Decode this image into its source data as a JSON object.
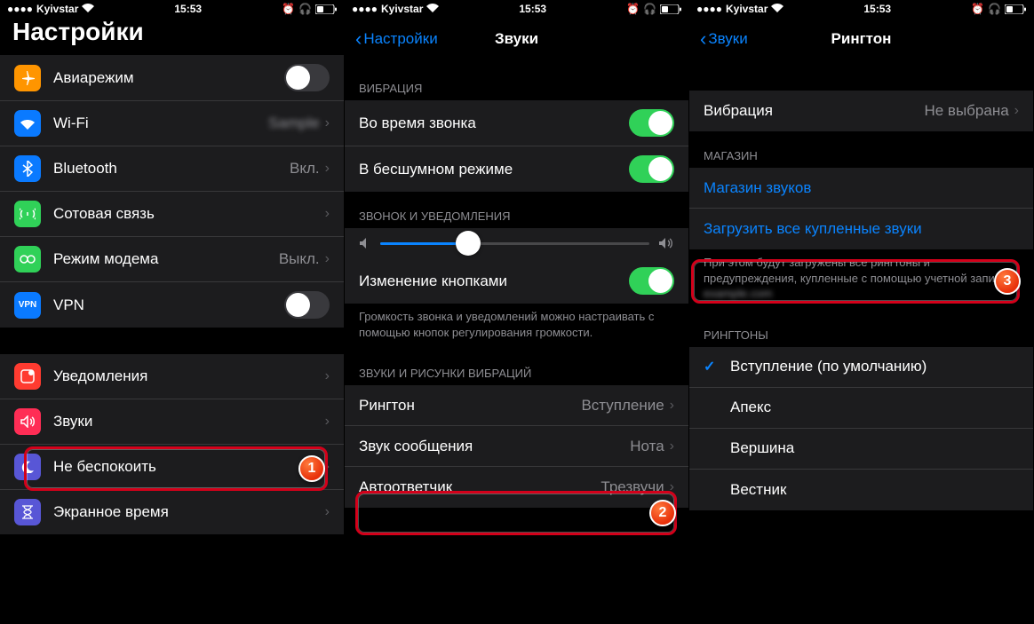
{
  "status": {
    "carrier": "Kyivstar",
    "time": "15:53"
  },
  "screen1": {
    "title": "Настройки",
    "group1": [
      {
        "icon": "airplane",
        "color": "#ff9500",
        "label": "Авиарежим",
        "toggle": false
      },
      {
        "icon": "wifi",
        "color": "#0a7aff",
        "label": "Wi-Fi",
        "value": "",
        "chevron": true
      },
      {
        "icon": "bluetooth",
        "color": "#0a7aff",
        "label": "Bluetooth",
        "value": "Вкл.",
        "chevron": true
      },
      {
        "icon": "cellular",
        "color": "#30d158",
        "label": "Сотовая связь",
        "chevron": true
      },
      {
        "icon": "hotspot",
        "color": "#30d158",
        "label": "Режим модема",
        "value": "Выкл.",
        "chevron": true
      },
      {
        "icon": "vpn",
        "color": "#0a7aff",
        "label": "VPN",
        "toggle": false
      }
    ],
    "group2": [
      {
        "icon": "notif",
        "color": "#ff3b30",
        "label": "Уведомления",
        "chevron": true
      },
      {
        "icon": "sound",
        "color": "#ff2d55",
        "label": "Звуки",
        "chevron": true
      },
      {
        "icon": "dnd",
        "color": "#5856d6",
        "label": "Не беспокоить",
        "chevron": true
      },
      {
        "icon": "screentime",
        "color": "#5856d6",
        "label": "Экранное время",
        "chevron": true
      }
    ]
  },
  "screen2": {
    "back": "Настройки",
    "title": "Звуки",
    "vibration_header": "ВИБРАЦИЯ",
    "vibration": [
      {
        "label": "Во время звонка",
        "toggle": true
      },
      {
        "label": "В бесшумном режиме",
        "toggle": true
      }
    ],
    "ringer_header": "ЗВОНОК И УВЕДОМЛЕНИЯ",
    "change_buttons": "Изменение кнопками",
    "ringer_footer": "Громкость звонка и уведомлений можно настраивать с помощью кнопок регулирования громкости.",
    "patterns_header": "ЗВУКИ И РИСУНКИ ВИБРАЦИЙ",
    "patterns": [
      {
        "label": "Рингтон",
        "value": "Вступление"
      },
      {
        "label": "Звук сообщения",
        "value": "Нота"
      },
      {
        "label": "Автоответчик",
        "value": "Трезвучи"
      }
    ]
  },
  "screen3": {
    "back": "Звуки",
    "title": "Рингтон",
    "vibration_label": "Вибрация",
    "vibration_value": "Не выбрана",
    "store_header": "МАГАЗИН",
    "store_links": [
      "Магазин звуков",
      "Загрузить все купленные звуки"
    ],
    "store_footer": "При этом будут загружены все рингтоны и предупреждения, купленные с помощью учетной записи",
    "ringtones_header": "РИНГТОНЫ",
    "ringtones": [
      {
        "label": "Вступление (по умолчанию)",
        "checked": true
      },
      {
        "label": "Апекс"
      },
      {
        "label": "Вершина"
      },
      {
        "label": "Вестник"
      }
    ]
  },
  "callouts": {
    "one": "1",
    "two": "2",
    "three": "3"
  }
}
